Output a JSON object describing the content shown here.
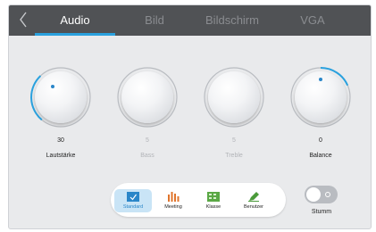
{
  "tabs": [
    {
      "label": "Audio",
      "active": true
    },
    {
      "label": "Bild",
      "active": false
    },
    {
      "label": "Bildschirm",
      "active": false
    },
    {
      "label": "VGA",
      "active": false
    }
  ],
  "knobs": [
    {
      "label": "Lautstärke",
      "value": "30",
      "enabled": true
    },
    {
      "label": "Bass",
      "value": "5",
      "enabled": false
    },
    {
      "label": "Treble",
      "value": "5",
      "enabled": false
    },
    {
      "label": "Balance",
      "value": "0",
      "enabled": true
    }
  ],
  "modes": [
    {
      "label": "Standard",
      "icon": "standard-icon",
      "selected": true
    },
    {
      "label": "Meeting",
      "icon": "equalizer-icon",
      "selected": false
    },
    {
      "label": "Klasse",
      "icon": "classroom-icon",
      "selected": false
    },
    {
      "label": "Benutzer",
      "icon": "pen-icon",
      "selected": false
    }
  ],
  "mute": {
    "label": "Stumm",
    "on": false
  },
  "colors": {
    "accent": "#2aa1de",
    "tabbar": "#505255",
    "panel": "#e9eaec"
  }
}
